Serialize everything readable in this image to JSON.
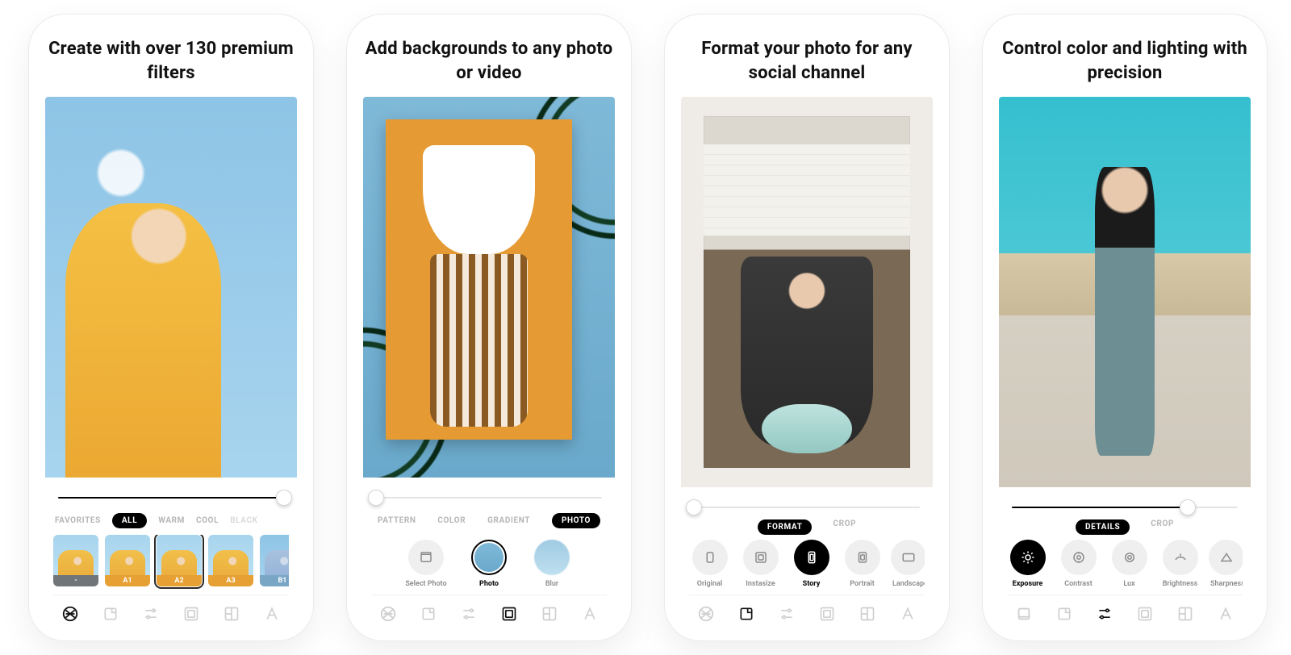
{
  "cards": [
    {
      "headline": "Create with over 130 premium filters",
      "slider": {
        "fill": 100,
        "knob": 100
      },
      "tabs": [
        "FAVORITES",
        "ALL",
        "WARM",
        "COOL",
        "BLACK"
      ],
      "tabs_selected_index": 1,
      "filters": [
        {
          "label": "-",
          "scheme": "gray",
          "selected": false
        },
        {
          "label": "A1",
          "scheme": "a",
          "selected": false
        },
        {
          "label": "A2",
          "scheme": "a",
          "selected": true
        },
        {
          "label": "A3",
          "scheme": "a",
          "selected": false
        },
        {
          "label": "B1",
          "scheme": "b",
          "selected": false
        }
      ],
      "toolbar_active_index": 0
    },
    {
      "headline": "Add backgrounds to any photo or video",
      "slider": {
        "fill": 0,
        "knob": 0
      },
      "tabs": [
        "PATTERN",
        "COLOR",
        "GRADIENT",
        "PHOTO"
      ],
      "tabs_selected_index": 3,
      "options": [
        {
          "label": "Select Photo",
          "variant": "chip",
          "active": false
        },
        {
          "label": "Photo",
          "variant": "ring",
          "active": true
        },
        {
          "label": "Blur",
          "variant": "skychip",
          "active": false
        }
      ],
      "toolbar_active_index": 3
    },
    {
      "headline": "Format your photo for any social channel",
      "slider": {
        "fill": 0,
        "knob": 0
      },
      "heading_tabs": [
        "FORMAT",
        "CROP"
      ],
      "heading_selected_index": 0,
      "options": [
        {
          "label": "Original",
          "variant": "chip",
          "active": false
        },
        {
          "label": "Instasize",
          "variant": "chip",
          "active": false
        },
        {
          "label": "Story",
          "variant": "black",
          "active": true
        },
        {
          "label": "Portrait",
          "variant": "chip",
          "active": false
        },
        {
          "label": "Landscape",
          "variant": "chip",
          "active": false
        }
      ],
      "toolbar_active_index": 1
    },
    {
      "headline": "Control color and lighting with precision",
      "slider": {
        "fill": 78,
        "knob": 78
      },
      "heading_tabs": [
        "DETAILS",
        "CROP"
      ],
      "heading_selected_index": 0,
      "options": [
        {
          "label": "Exposure",
          "variant": "black",
          "active": true
        },
        {
          "label": "Contrast",
          "variant": "chip",
          "active": false
        },
        {
          "label": "Lux",
          "variant": "chip",
          "active": false
        },
        {
          "label": "Brightness",
          "variant": "chip",
          "active": false
        },
        {
          "label": "Sharpness",
          "variant": "chip",
          "active": false
        }
      ],
      "toolbar_active_index": 2
    }
  ],
  "toolbar_icons": [
    "filters-icon",
    "crop-icon",
    "adjust-icon",
    "borders-icon",
    "collage-icon",
    "text-icon"
  ]
}
